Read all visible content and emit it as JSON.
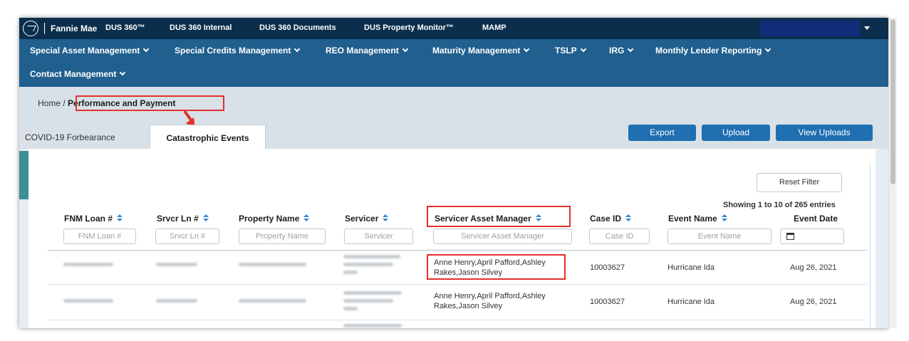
{
  "brand": "Fannie Mae",
  "top_nav": [
    "DUS 360™",
    "DUS 360 Internal",
    "DUS 360 Documents",
    "DUS Property Monitor™",
    "MAMP"
  ],
  "main_menu": [
    "Special Asset Management",
    "Special Credits Management",
    "REO Management",
    "Maturity Management",
    "TSLP",
    "IRG",
    "Monthly Lender Reporting",
    "Contact Management"
  ],
  "breadcrumb": {
    "home": "Home",
    "separator": "/",
    "current": "Performance and Payment"
  },
  "tabs": [
    {
      "label": "COVID-19 Forbearance",
      "active": false
    },
    {
      "label": "Catastrophic Events",
      "active": true
    }
  ],
  "actions": {
    "export": "Export",
    "upload": "Upload",
    "view_uploads": "View Uploads"
  },
  "table": {
    "reset_filter": "Reset Filter",
    "showing": "Showing 1 to 10 of 265 entries",
    "columns": [
      "FNM Loan #",
      "Srvcr Ln #",
      "Property Name",
      "Servicer",
      "Servicer Asset Manager",
      "Case ID",
      "Event Name",
      "Event Date"
    ],
    "filter_placeholders": [
      "FNM Loan #",
      "Srvcr Ln #",
      "Property Name",
      "Servicer",
      "Servicer Asset Manager",
      "Case ID",
      "Event Name"
    ],
    "rows": [
      {
        "asset_manager_line1": "Anne Henry,April Pafford,Ashley",
        "asset_manager_line2": "Rakes,Jason Silvey",
        "case_id": "10003627",
        "event_name": "Hurricane Ida",
        "event_date": "Aug 26, 2021"
      },
      {
        "asset_manager_line1": "Anne Henry,April Pafford,Ashley",
        "asset_manager_line2": "Rakes,Jason Silvey",
        "case_id": "10003627",
        "event_name": "Hurricane Ida",
        "event_date": "Aug 26, 2021"
      }
    ]
  },
  "colors": {
    "topbar": "#0b2e4d",
    "menubar": "#205f8e",
    "button": "#1f6fb1",
    "highlight": "#e3312d",
    "sort_icon": "#2f89d6"
  }
}
